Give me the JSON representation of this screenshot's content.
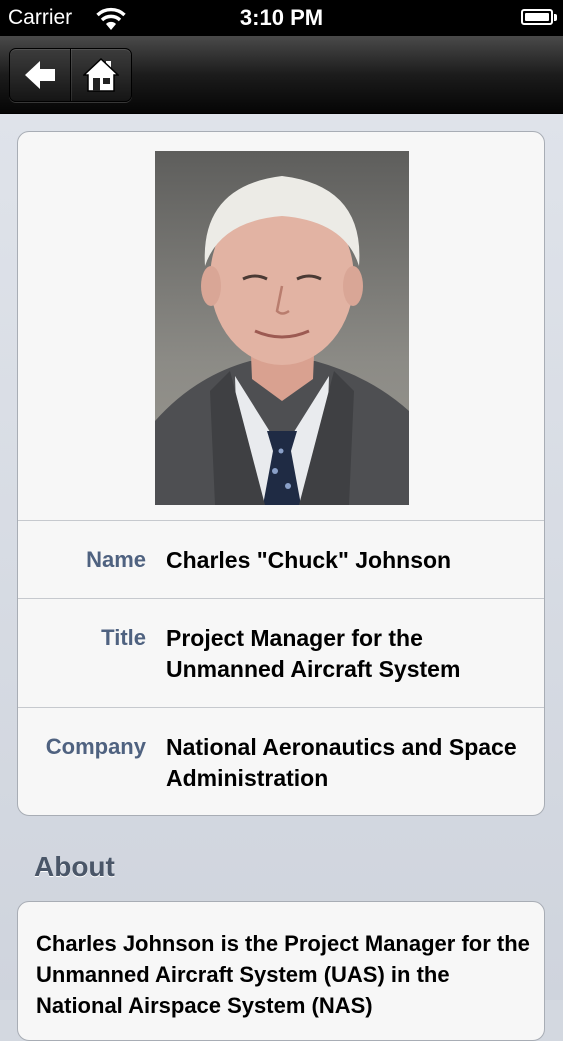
{
  "status_bar": {
    "carrier": "Carrier",
    "time": "3:10 PM"
  },
  "nav": {
    "back_icon": "back-arrow-icon",
    "home_icon": "home-icon"
  },
  "profile": {
    "photo_alt": "Portrait photo",
    "fields": [
      {
        "label": "Name",
        "value": "Charles \"Chuck\" Johnson"
      },
      {
        "label": "Title",
        "value": "Project Manager for the Unmanned Aircraft System"
      },
      {
        "label": "Company",
        "value": "National Aeronautics and Space Administration"
      }
    ]
  },
  "about": {
    "heading": "About",
    "text": "Charles Johnson is the Project Manager for the Unmanned Aircraft System (UAS) in the National Airspace System (NAS)"
  }
}
